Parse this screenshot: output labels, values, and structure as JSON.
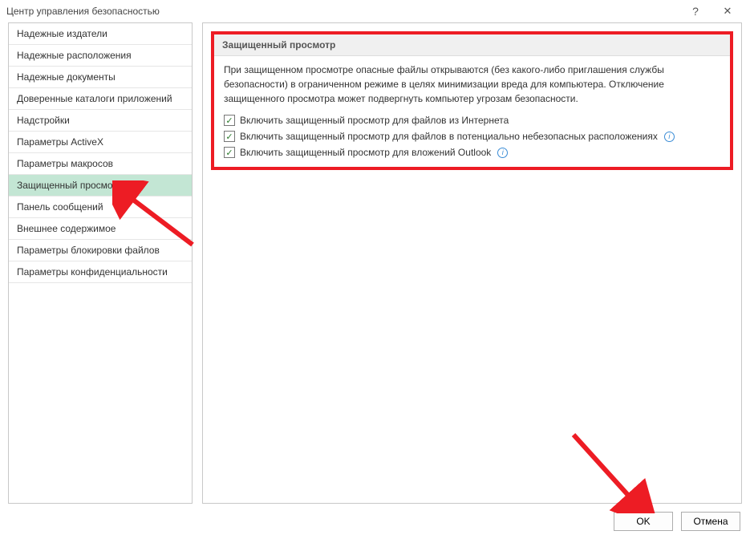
{
  "window": {
    "title": "Центр управления безопасностью",
    "help": "?",
    "close": "✕"
  },
  "sidebar": {
    "items": [
      {
        "label": "Надежные издатели"
      },
      {
        "label": "Надежные расположения"
      },
      {
        "label": "Надежные документы"
      },
      {
        "label": "Доверенные каталоги приложений"
      },
      {
        "label": "Надстройки"
      },
      {
        "label": "Параметры ActiveX"
      },
      {
        "label": "Параметры макросов"
      },
      {
        "label": "Защищенный просмотр"
      },
      {
        "label": "Панель сообщений"
      },
      {
        "label": "Внешнее содержимое"
      },
      {
        "label": "Параметры блокировки файлов"
      },
      {
        "label": "Параметры конфиденциальности"
      }
    ],
    "selectedIndex": 7
  },
  "section": {
    "header": "Защищенный просмотр",
    "description": "При защищенном просмотре опасные файлы открываются (без какого-либо приглашения службы безопасности) в ограниченном режиме в целях минимизации вреда для компьютера. Отключение защищенного просмотра может подвергнуть компьютер угрозам безопасности.",
    "checkboxes": [
      {
        "label": "Включить защищенный просмотр для файлов из Интернета",
        "checked": true,
        "info": false
      },
      {
        "label": "Включить защищенный просмотр для файлов в потенциально небезопасных расположениях",
        "checked": true,
        "info": true
      },
      {
        "label": "Включить защищенный просмотр для вложений Outlook",
        "checked": true,
        "info": true
      }
    ]
  },
  "buttons": {
    "ok": "OK",
    "cancel": "Отмена"
  }
}
